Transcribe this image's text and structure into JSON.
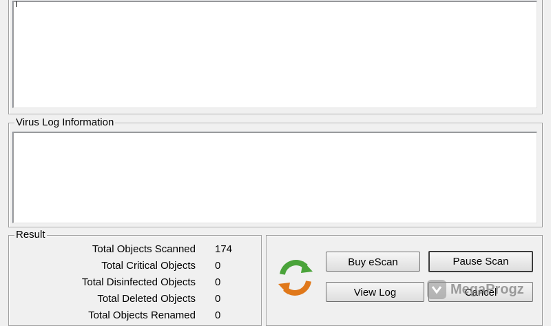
{
  "virus_log": {
    "legend": "Virus Log Information"
  },
  "result": {
    "legend": "Result",
    "rows": [
      {
        "label": "Total Objects Scanned",
        "value": "174"
      },
      {
        "label": "Total Critical Objects",
        "value": "0"
      },
      {
        "label": "Total Disinfected Objects",
        "value": "0"
      },
      {
        "label": "Total Deleted Objects",
        "value": "0"
      },
      {
        "label": "Total Objects Renamed",
        "value": "0"
      }
    ]
  },
  "buttons": {
    "buy": "Buy eScan",
    "pause": "Pause Scan",
    "view_log": "View Log",
    "cancel": "Cancel"
  },
  "watermark": {
    "text": "MegaProgz"
  },
  "icons": {
    "scan_status": "refresh-arrows-icon",
    "watermark_logo": "megaprogz-logo-icon"
  },
  "colors": {
    "arrow_orange": "#e0781a",
    "arrow_green": "#4aa33a"
  }
}
